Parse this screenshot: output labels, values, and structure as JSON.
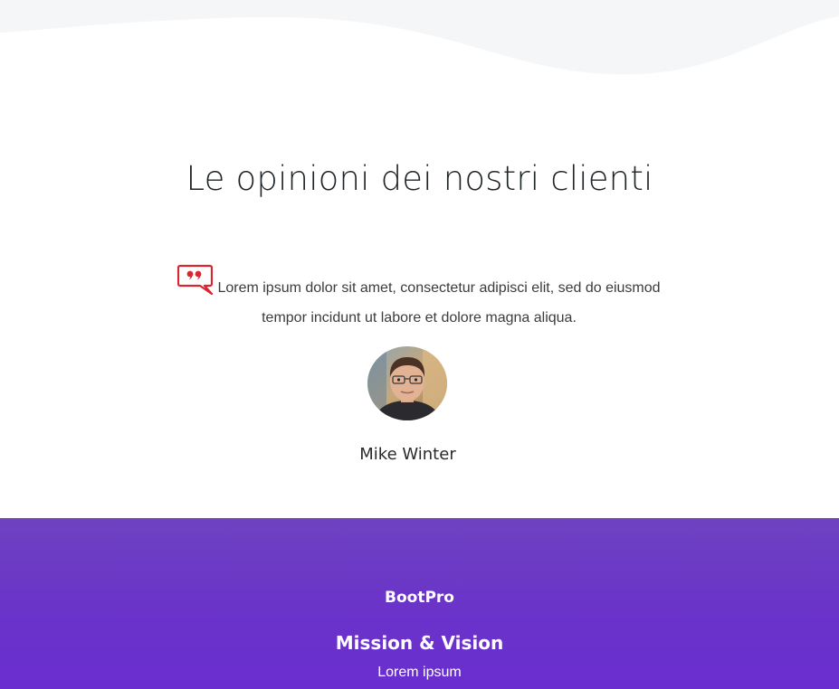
{
  "colors": {
    "wave": "#f5f6f8",
    "title": "#1e2326",
    "quote_icon": "#d9262f",
    "footer_bg": "#6a33c9",
    "footer_text": "#ffffff"
  },
  "testimonials": {
    "title": "Le opinioni dei nostri clienti",
    "quote_icon": "speech-bubble-quote-icon",
    "quote_text": "Lorem ipsum dolor sit amet, consectetur adipisci elit, sed do eiusmod tempor incidunt ut labore et dolore magna aliqua.",
    "author_name": "Mike Winter"
  },
  "footer": {
    "brand": "BootPro",
    "heading": "Mission & Vision",
    "text": "Lorem ipsum"
  }
}
